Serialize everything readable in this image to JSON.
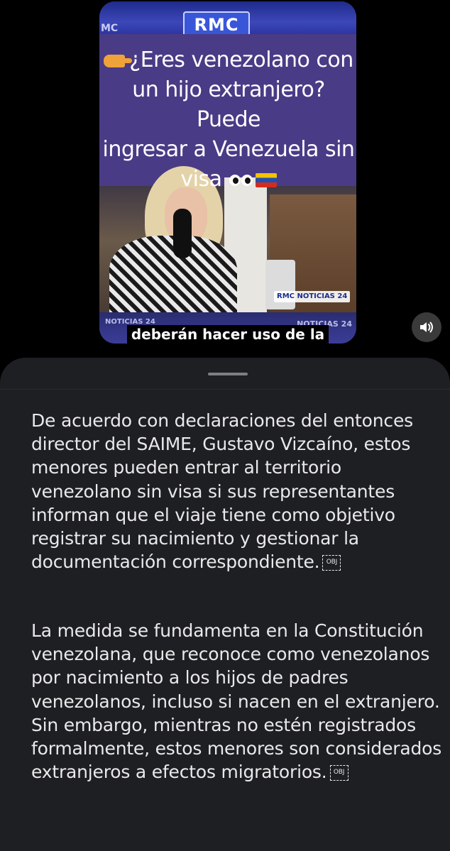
{
  "video": {
    "logo": "RMC",
    "logo_left_partial": "MC",
    "headline_line1": "¿Eres venezolano con",
    "headline_line2": "un hijo extranjero? Puede",
    "headline_line3": "ingresar a Venezuela sin",
    "headline_line4": "visa",
    "badge": "RMC NOTICIAS 24",
    "band_left": "NOTICIAS 24",
    "band_right": "NOTICIAS 24",
    "caption": "deberán hacer uso de la",
    "headline_icons": [
      "pointing-hand-icon",
      "eyes-icon",
      "venezuela-flag-icon"
    ],
    "flag_colors": [
      "#f4c300",
      "#1f4fb0",
      "#d52b1e"
    ]
  },
  "controls": {
    "volume_icon": "speaker-icon"
  },
  "sheet": {
    "paragraph1": "De acuerdo con declaraciones del entonces director del SAIME, Gustavo Vizcaíno, estos menores pueden entrar al territorio venezolano sin visa si sus representantes informan que el viaje tiene como objetivo registrar su nacimiento y gestionar la documentación correspondiente.",
    "paragraph2": "La medida se fundamenta en la Constitución venezolana, que reconoce como venezolanos por nacimiento a los hijos de padres venezolanos, incluso si nacen en el extranjero. Sin embargo, mientras no estén registrados formalmente, estos menores son considerados extranjeros a efectos migratorios.",
    "obj_marker": "OBJ"
  }
}
